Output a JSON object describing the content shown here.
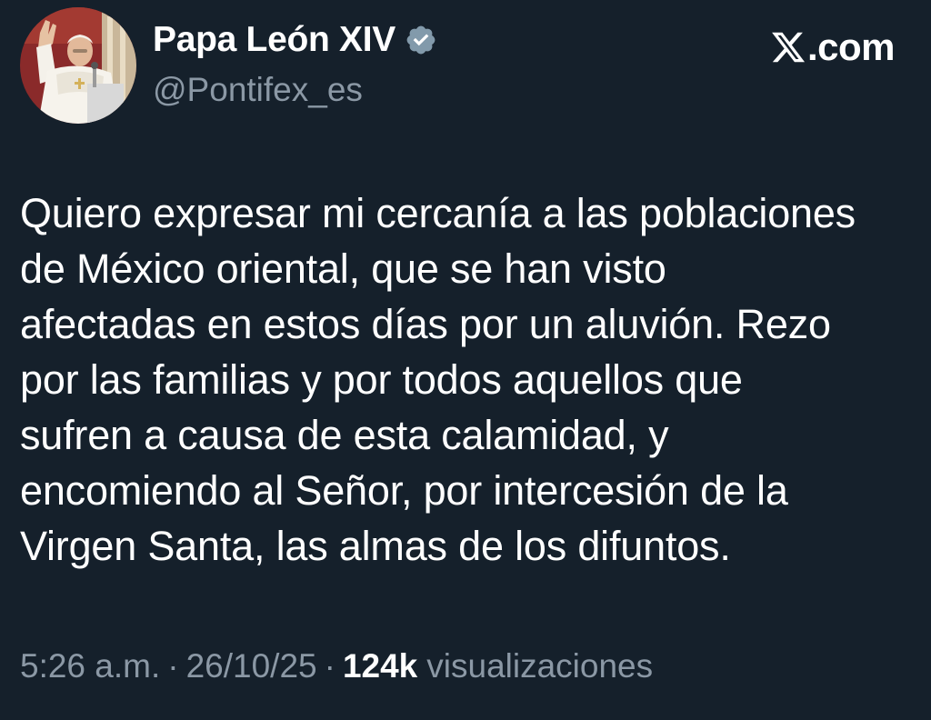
{
  "author": {
    "display_name": "Papa León XIV",
    "handle": "@Pontifex_es",
    "verified": true,
    "avatar_icon": "pope-waving-avatar"
  },
  "brand": {
    "text": ".com",
    "icon": "x-logo-icon"
  },
  "tweet": {
    "text": "Quiero expresar mi cercanía a las poblaciones\nde México oriental, que se han visto\nafectadas en estos días por un aluvión. Rezo\npor las familias y por todos aquellos que\nsufren a causa de esta calamidad, y\nencomiendo al Señor, por intercesión de la\nVirgen Santa, las almas de los difuntos."
  },
  "meta": {
    "time": "5:26 a.m.",
    "separator": "·",
    "date": "26/10/25",
    "views_count": "124k",
    "views_label": "visualizaciones"
  },
  "colors": {
    "background": "#15202b",
    "text": "#ffffff",
    "secondary": "#8b98a5",
    "verified_badge": "#829aab"
  }
}
